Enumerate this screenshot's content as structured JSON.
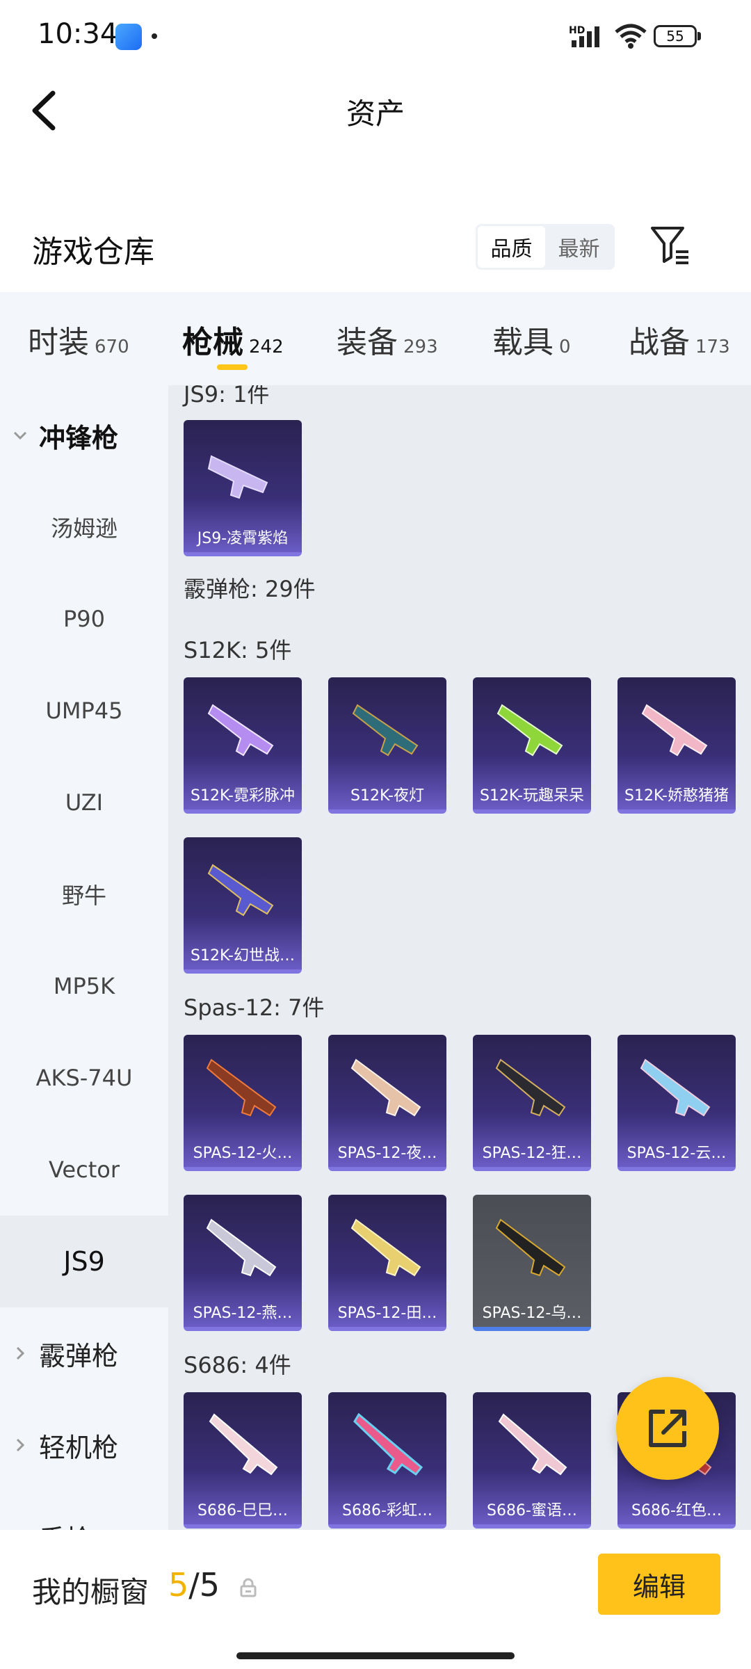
{
  "status_bar": {
    "time": "10:34",
    "network": "HD",
    "battery": "55"
  },
  "header": {
    "title": "资产"
  },
  "warehouse": {
    "title": "游戏仓库",
    "sort_options": [
      "品质",
      "最新"
    ],
    "sort_selected": "品质"
  },
  "tabs": [
    {
      "label": "时装",
      "count": "670"
    },
    {
      "label": "枪械",
      "count": "242",
      "active": true
    },
    {
      "label": "装备",
      "count": "293"
    },
    {
      "label": "载具",
      "count": "0"
    },
    {
      "label": "战备",
      "count": "173"
    }
  ],
  "sidebar": {
    "groups": [
      {
        "label": "冲锋枪",
        "open": true
      },
      {
        "label": "霰弹枪"
      },
      {
        "label": "轻机枪"
      },
      {
        "label": "手枪"
      }
    ],
    "items": [
      "汤姆逊",
      "P90",
      "UMP45",
      "UZI",
      "野牛",
      "MP5K",
      "AKS-74U",
      "Vector",
      "JS9"
    ],
    "active_item": "JS9"
  },
  "sections": [
    {
      "title": "JS9: 1件",
      "items": [
        "JS9-凌霄紫焰"
      ]
    },
    {
      "title": "霰弹枪: 29件",
      "items": []
    },
    {
      "title": "S12K: 5件",
      "items": [
        "S12K-霓彩脉冲",
        "S12K-夜灯",
        "S12K-玩趣呆呆",
        "S12K-娇憨猪猪",
        "S12K-幻世战…"
      ]
    },
    {
      "title": "Spas-12: 7件",
      "items": [
        "SPAS-12-火…",
        "SPAS-12-夜…",
        "SPAS-12-狂…",
        "SPAS-12-云…",
        "SPAS-12-燕…",
        "SPAS-12-田…",
        "SPAS-12-乌…"
      ]
    },
    {
      "title": "S686: 4件",
      "items": [
        "S686-巳巳…",
        "S686-彩虹…",
        "S686-蜜语…",
        "S686-红色…"
      ]
    }
  ],
  "showcase": {
    "label": "我的橱窗",
    "current": "5",
    "total": "/5"
  },
  "edit_label": "编辑",
  "colors": {
    "accent": "#ffc21a",
    "card_top": "#2a2350",
    "card_bottom": "#6a5cc4"
  }
}
